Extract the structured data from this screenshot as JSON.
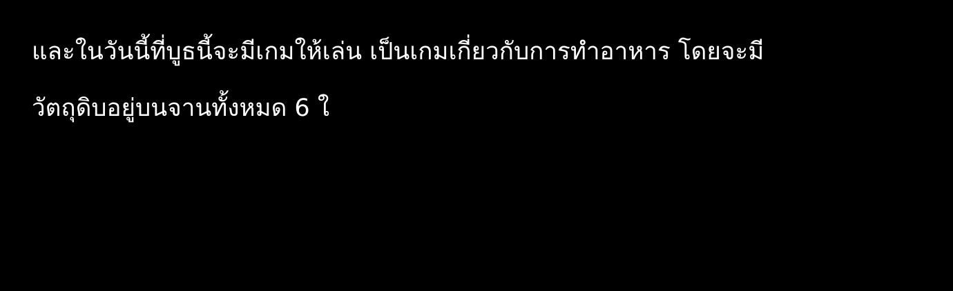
{
  "caption": {
    "line1": "และในวันนี้ที่บูธนี้จะมีเกมให้เล่น เป็นเกมเกี่ยวกับการทำอาหาร โดยจะมี",
    "line2": "วัตถุดิบอยู่บนจานทั้งหมด 6 ใ"
  },
  "colors": {
    "background": "#000000",
    "text": "#ffffff"
  }
}
